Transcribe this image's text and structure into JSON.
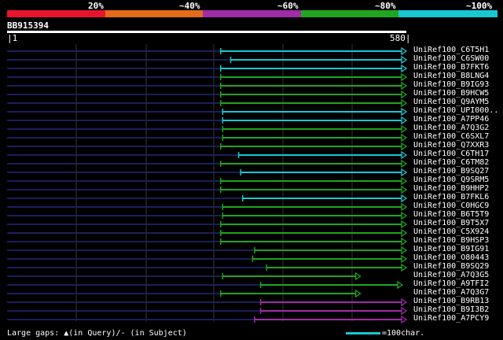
{
  "scale": [
    {
      "label": "20%",
      "color": "#e8142c"
    },
    {
      "label": "~40%",
      "color": "#e56a1a"
    },
    {
      "label": "~60%",
      "color": "#a02ca8"
    },
    {
      "label": "~80%",
      "color": "#1fa51f"
    },
    {
      "label": "~100%",
      "color": "#18c7d2"
    }
  ],
  "query": {
    "id": "BB915394",
    "start": "1",
    "end": "580"
  },
  "hits": [
    {
      "name": "UniRef100_C6T5H1",
      "start": 0.535,
      "color": "#18c7d2"
    },
    {
      "name": "UniRef100_C6SW00",
      "start": 0.56,
      "color": "#18c7d2"
    },
    {
      "name": "UniRef100_B7FKT6",
      "start": 0.535,
      "color": "#18c7d2"
    },
    {
      "name": "UniRef100_B8LNG4",
      "start": 0.535,
      "color": "#1fa51f"
    },
    {
      "name": "UniRef100_B9IG93",
      "start": 0.535,
      "color": "#1fa51f"
    },
    {
      "name": "UniRef100_B9HCW5",
      "start": 0.535,
      "color": "#1fa51f"
    },
    {
      "name": "UniRef100_Q9AYM5",
      "start": 0.535,
      "color": "#1fa51f"
    },
    {
      "name": "UniRef100_UPI000..",
      "start": 0.54,
      "color": "#18c7d2"
    },
    {
      "name": "UniRef100_A7PP46",
      "start": 0.54,
      "color": "#18c7d2"
    },
    {
      "name": "UniRef100_A7Q3G2",
      "start": 0.54,
      "color": "#1fa51f"
    },
    {
      "name": "UniRef100_C6SXL7",
      "start": 0.54,
      "color": "#1fa51f"
    },
    {
      "name": "UniRef100_Q7XXR3",
      "start": 0.535,
      "color": "#1fa51f"
    },
    {
      "name": "UniRef100_C6TH17",
      "start": 0.58,
      "color": "#18c7d2"
    },
    {
      "name": "UniRef100_C6TM82",
      "start": 0.535,
      "color": "#1fa51f"
    },
    {
      "name": "UniRef100_B9SQ27",
      "start": 0.585,
      "color": "#18c7d2"
    },
    {
      "name": "UniRef100_Q9SRM5",
      "start": 0.535,
      "color": "#1fa51f"
    },
    {
      "name": "UniRef100_B9HHP2",
      "start": 0.535,
      "color": "#1fa51f"
    },
    {
      "name": "UniRef100_B7FKL6",
      "start": 0.59,
      "color": "#18c7d2"
    },
    {
      "name": "UniRef100_C0HGC9",
      "start": 0.54,
      "color": "#1fa51f"
    },
    {
      "name": "UniRef100_B6T5T9",
      "start": 0.54,
      "color": "#1fa51f"
    },
    {
      "name": "UniRef100_B9T5X7",
      "start": 0.535,
      "color": "#1fa51f"
    },
    {
      "name": "UniRef100_C5X924",
      "start": 0.535,
      "color": "#1fa51f"
    },
    {
      "name": "UniRef100_B9HSP3",
      "start": 0.535,
      "color": "#1fa51f"
    },
    {
      "name": "UniRef100_B9IG91",
      "start": 0.62,
      "color": "#1fa51f"
    },
    {
      "name": "UniRef100_O80443",
      "start": 0.615,
      "color": "#1fa51f"
    },
    {
      "name": "UniRef100_B9SQ29",
      "start": 0.65,
      "color": "#1fa51f"
    },
    {
      "name": "UniRef100_A7Q3G5",
      "start": 0.54,
      "end": 0.885,
      "color": "#1fa51f"
    },
    {
      "name": "UniRef100_A9TFI2",
      "start": 0.635,
      "end": 0.99,
      "color": "#1fa51f"
    },
    {
      "name": "UniRef100_A7Q3G7",
      "start": 0.535,
      "end": 0.885,
      "color": "#1fa51f"
    },
    {
      "name": "UniRef100_B9RB13",
      "start": 0.635,
      "color": "#a02ca8"
    },
    {
      "name": "UniRef100_B9I3B2",
      "start": 0.635,
      "color": "#a02ca8"
    },
    {
      "name": "UniRef100_A7PCY9",
      "start": 0.62,
      "color": "#a02ca8"
    }
  ],
  "footer": {
    "large_gaps": "Large gaps: ▲(in Query)/- (in Subject)",
    "scale_text": "=100char."
  }
}
